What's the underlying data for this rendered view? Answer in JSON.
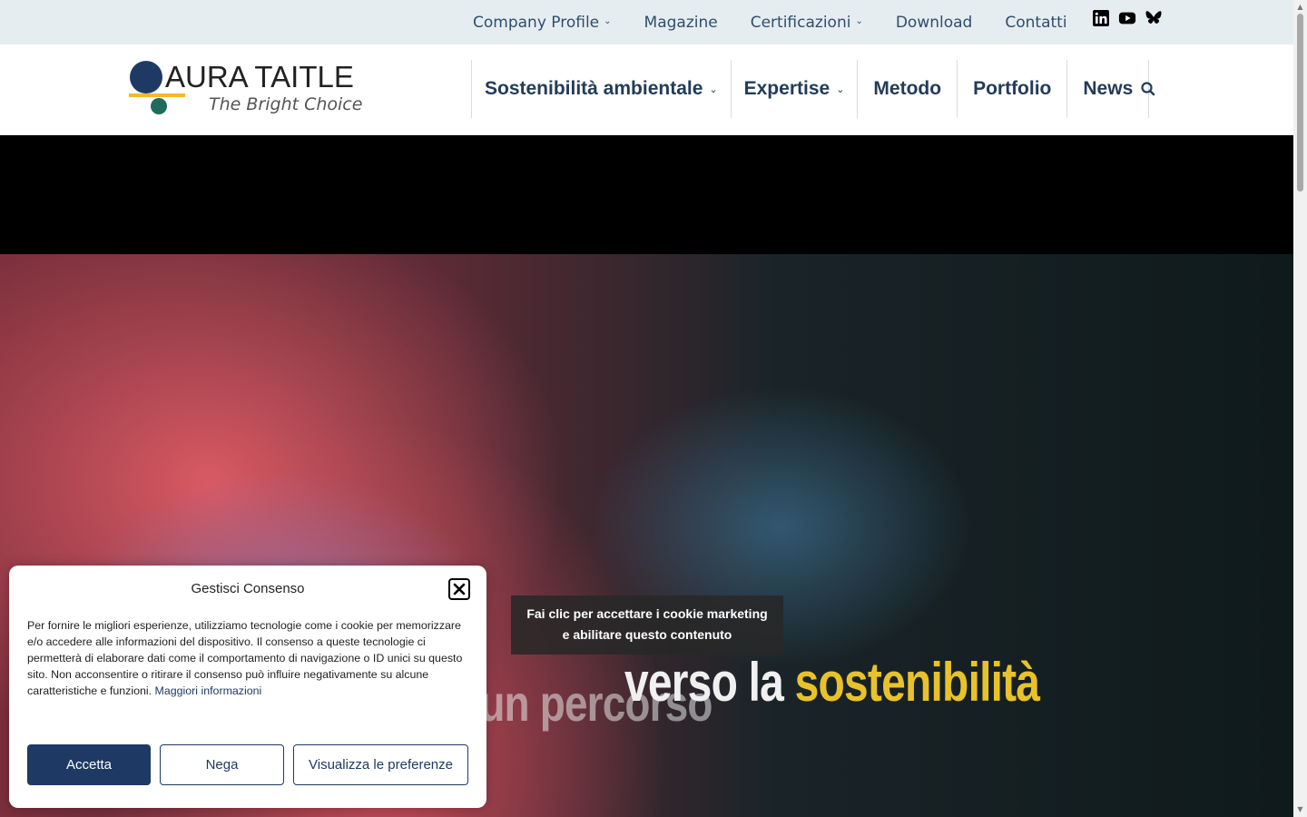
{
  "topnav": {
    "items": [
      {
        "label": "Company Profile",
        "has_dropdown": true
      },
      {
        "label": "Magazine",
        "has_dropdown": false
      },
      {
        "label": "Certificazioni",
        "has_dropdown": true
      },
      {
        "label": "Download",
        "has_dropdown": false
      },
      {
        "label": "Contatti",
        "has_dropdown": false
      }
    ],
    "social": [
      "linkedin-icon",
      "youtube-icon",
      "bluesky-icon"
    ]
  },
  "logo": {
    "name": "AURA TAITLE",
    "tagline": "The Bright Choice"
  },
  "mainnav": {
    "items": [
      {
        "label": "Sostenibilità ambientale",
        "has_dropdown": true
      },
      {
        "label": "Expertise",
        "has_dropdown": true
      },
      {
        "label": "Metodo",
        "has_dropdown": false
      },
      {
        "label": "Portfolio",
        "has_dropdown": false
      },
      {
        "label": "News",
        "has_dropdown": false
      }
    ],
    "search_icon": "search-icon"
  },
  "hero": {
    "line1": "si disegna un percorso",
    "line2_prefix": "verso la ",
    "line2_highlight": "sostenibilità",
    "consent_overlay": {
      "line1": "Fai clic per accettare i cookie marketing",
      "line2": "e abilitare questo contenuto"
    }
  },
  "cookie": {
    "title": "Gestisci Consenso",
    "body": "Per fornire le migliori esperienze, utilizziamo tecnologie come i cookie per memorizzare e/o accedere alle informazioni del dispositivo. Il consenso a queste tecnologie ci permetterà di elaborare dati come il comportamento di navigazione o ID unici su questo sito. Non acconsentire o ritirare il consenso può influire negativamente su alcune caratteristiche e funzioni.",
    "more_link": "Maggiori informazioni",
    "accept": "Accetta",
    "deny": "Nega",
    "prefs": "Visualizza le preferenze"
  },
  "colors": {
    "topbar_bg": "#e6edf1",
    "nav_text": "#233c58",
    "primary": "#1e3a64",
    "logo_blue": "#1e3a64",
    "logo_yellow": "#f2b92a",
    "logo_green": "#1f6b5c",
    "highlight_yellow": "#e8c22a"
  }
}
